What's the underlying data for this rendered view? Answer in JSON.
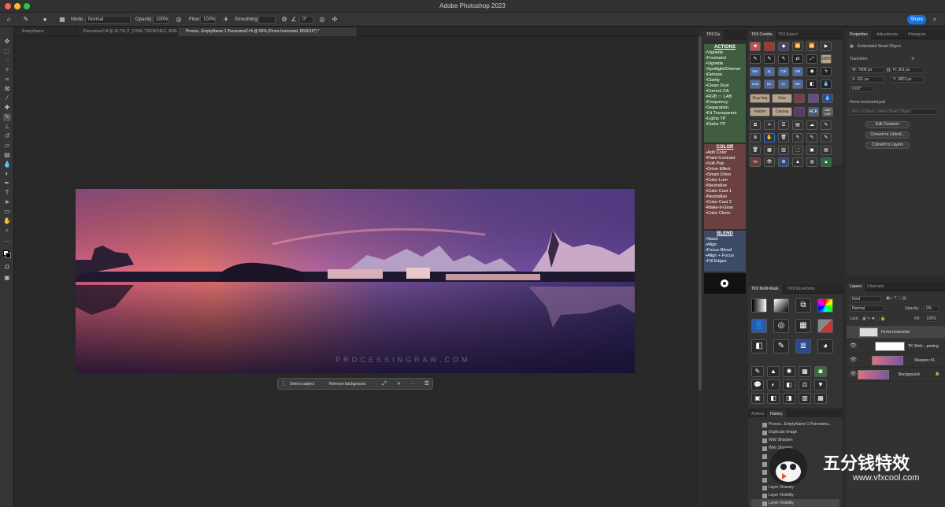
{
  "app": {
    "title": "Adobe Photoshop 2023"
  },
  "options_bar": {
    "mode_label": "Mode:",
    "mode_value": "Normal",
    "opacity_label": "Opacity:",
    "opacity_value": "100%",
    "flow_label": "Flow:",
    "flow_value": "100%",
    "smoothing_label": "Smoothing:",
    "angle_value": "0°",
    "share_label": "Share"
  },
  "doc_tabs": [
    {
      "label": "EmptyName"
    },
    {
      "label": "Panorama2.tif @ 16.7% (T_FINAL TRENCHES, RGB/16) *"
    },
    {
      "label": "Proces...EmptyName 1 Panorama2-Hi @ 50% (Firms-horizontal, RGB/16*) *"
    }
  ],
  "tk_ca": {
    "tab": "TK9 Ca",
    "actions_header": "ACTIONS",
    "actions": [
      "Vignette",
      "Freehand",
      "Vignette",
      "Spotlight/Dimmer",
      "Dehaze",
      "Clarity",
      "Clean Dust",
      "Correct CA",
      "RGB ↑↑ LAB",
      "Frequency",
      "Separation",
      "Fit Transparent",
      "Lights TP",
      "Darks TP"
    ],
    "color_header": "COLOR",
    "color": [
      "Add Color",
      "Paint Contrast",
      "Soft Pop",
      "Orton Effect",
      "Smart Orton",
      "Color Lum",
      "Neutralize",
      "Color Cast 1",
      "Neutralize",
      "Color Cast 2",
      "Make-it-Glow",
      "Color Clone"
    ],
    "blend_header": "BLEND",
    "blend": [
      "Stack",
      "Align",
      "Focus Blend",
      "Align + Focus",
      "Fill Edges"
    ]
  },
  "tk_combo": {
    "tabs": [
      "TK9 Combo",
      "TK9 Export"
    ],
    "row_labels_1": [
      "Ber",
      "3L",
      "Cal",
      "Sel"
    ],
    "row_labels_2": [
      "Lum",
      "DL",
      "LL",
      "ML"
    ],
    "wide_buttons": [
      "Dup Img",
      "Size"
    ],
    "wide_buttons_2": [
      "Flatten",
      "Canvas"
    ],
    "pct_label": "100%",
    "acr_label": "ACR",
    "sp_label": "S&P CAP"
  },
  "properties": {
    "tabs": [
      "Properties",
      "Adjustments",
      "Histogram"
    ],
    "object_type": "Embedded Smart Object",
    "transform_label": "Transform",
    "w_value": "W: 7808 px",
    "h_value": "H: 361 px",
    "x_value": "X: 331 px",
    "y_value": "Y: 3823 px",
    "angle_value": "0.00°",
    "file_name": "Firms-horizontal.psb",
    "path_hint": "Not a Library Linked Smart Object",
    "buttons": [
      "Edit Contents",
      "Convert to Linked...",
      "Convert to Layers"
    ]
  },
  "multi_mask": {
    "tabs": [
      "TK9 Multi-Mask",
      "TK9 My Actions"
    ]
  },
  "history": {
    "tabs": [
      "Actions",
      "History"
    ],
    "items": [
      "Proces...EmptyName 1 Panorama...",
      "Duplicate Image",
      "Web Sharpen",
      "Web Sharpen",
      "",
      "",
      "",
      "",
      "Layer Visibility",
      "Layer Visibility",
      "Layer Visibility"
    ]
  },
  "layers": {
    "tabs": [
      "Layers",
      "Channels"
    ],
    "kind_label": "Kind",
    "blend_mode": "Normal",
    "opacity_label": "Opacity:",
    "opacity_value": "0%",
    "lock_label": "Lock:",
    "fill_label": "Fill:",
    "fill_value": "100%",
    "items": [
      {
        "name": "Firms-horizontal"
      },
      {
        "name": "TK Web-...pening"
      },
      {
        "name": "Sharpen #1"
      },
      {
        "name": "Background"
      }
    ]
  },
  "context_bar": {
    "select_subject": "Select subject",
    "remove_background": "Remove background",
    "more": "···"
  },
  "photo_watermark": "PROCESSINGRAW.COM",
  "site_watermark": {
    "cn": "五分钱特效",
    "url": "www.vfxcool.com"
  },
  "colors": {
    "accent": "#1473e6",
    "actions_green": "#3f5e3f",
    "color_red": "#6a4040",
    "blend_blue": "#3c4a66"
  }
}
